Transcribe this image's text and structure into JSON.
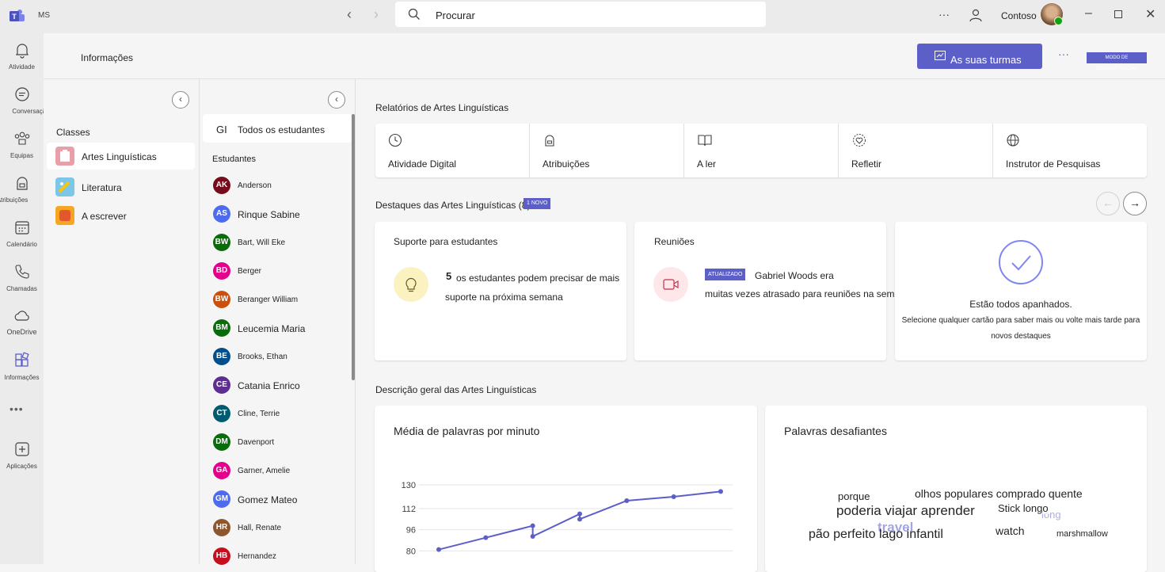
{
  "titlebar": {
    "org_short": "MS",
    "search_placeholder": "Procurar",
    "more": "···",
    "tenant": "Contoso"
  },
  "rail": [
    {
      "label": "Atividade",
      "icon": "bell-icon"
    },
    {
      "label": "Conversação",
      "icon": "chat-icon"
    },
    {
      "label": "Equipas",
      "icon": "teams-icon"
    },
    {
      "label": "Atribuições",
      "icon": "backpack-icon"
    },
    {
      "label": "Calendário",
      "icon": "calendar-icon"
    },
    {
      "label": "Chamadas",
      "icon": "phone-icon"
    },
    {
      "label": "OneDrive",
      "icon": "cloud-icon"
    },
    {
      "label": "Informações",
      "icon": "insights-icon"
    },
    {
      "label": "Aplicações",
      "icon": "add-apps-icon"
    }
  ],
  "rail_more": "•••",
  "header": {
    "title": "Informações",
    "primary_button": "As suas turmas",
    "more": "···",
    "demo_badge": "MODO DE DEMONSTRAÇÃO"
  },
  "classes": {
    "heading": "Classes",
    "items": [
      {
        "label": "Artes Linguísticas",
        "color": "#e8a0a8",
        "selected": true
      },
      {
        "label": "Literatura",
        "color": "#7cc7e8",
        "selected": false
      },
      {
        "label": "A escrever",
        "color": "#f5a623",
        "selected": false
      }
    ]
  },
  "students": {
    "all_initials": "GI",
    "all_label": "Todos os estudantes",
    "heading": "Estudantes",
    "items": [
      {
        "initials": "AK",
        "name": "Anderson",
        "color": "#750b1c"
      },
      {
        "initials": "AS",
        "name": "Rinque Sabine",
        "color": "#4f6bed"
      },
      {
        "initials": "BW",
        "name": "Bart, Will Eke",
        "color": "#0b6a0b"
      },
      {
        "initials": "BD",
        "name": "Berger",
        "color": "#e3008c"
      },
      {
        "initials": "BW",
        "name": "Beranger William",
        "color": "#ca5010"
      },
      {
        "initials": "BM",
        "name": "Leucemia Maria",
        "color": "#0b6a0b"
      },
      {
        "initials": "BE",
        "name": "Brooks, Ethan",
        "color": "#004e8c"
      },
      {
        "initials": "CE",
        "name": "Catania Enrico",
        "color": "#5c2e91"
      },
      {
        "initials": "CT",
        "name": "Cline, Terrie",
        "color": "#005b70"
      },
      {
        "initials": "DM",
        "name": "Davenport",
        "color": "#0b6a0b"
      },
      {
        "initials": "GA",
        "name": "Garner, Amelie",
        "color": "#e3008c"
      },
      {
        "initials": "GM",
        "name": "Gomez Mateo",
        "color": "#4f6bed"
      },
      {
        "initials": "HR",
        "name": "Hall, Renate",
        "color": "#8e562e"
      },
      {
        "initials": "HB",
        "name": "Hernandez",
        "color": "#c50f1f"
      }
    ]
  },
  "main": {
    "reports_title": "Relatórios de Artes Linguísticas",
    "reports": [
      {
        "label": "Atividade Digital",
        "icon": "clock-icon"
      },
      {
        "label": "Atribuições",
        "icon": "backpack-icon"
      },
      {
        "label": "A ler",
        "icon": "book-icon"
      },
      {
        "label": "Refletir",
        "icon": "heart-icon"
      },
      {
        "label": "Instrutor de Pesquisas",
        "icon": "globe-icon"
      }
    ],
    "highlights_title": "Destaques das Artes Linguísticas (8)",
    "highlights_badge": "1 NOVO",
    "support_card": {
      "title": "Suporte para estudantes",
      "count": "5",
      "line1": "os estudantes podem precisar de mais",
      "line2": "suporte na próxima semana"
    },
    "meetings_card": {
      "title": "Reuniões",
      "badge": "ATUALIZADO",
      "line1": "Gabriel Woods era",
      "line2": "muitas vezes atrasado para reuniões na semana passada"
    },
    "caught_up_card": {
      "title": "Estão todos apanhados.",
      "line1": "Selecione qualquer cartão para saber mais ou volte mais tarde para",
      "line2": "novos destaques"
    },
    "overview_title": "Descrição geral das Artes Linguísticas",
    "wpm_card_title": "Média de palavras por minuto",
    "challenging_card_title": "Palavras desafiantes",
    "word_cloud": [
      {
        "text": "porque"
      },
      {
        "text": "olhos populares comprado quente"
      },
      {
        "text": "poderia viajar aprender"
      },
      {
        "text": "Stick longo"
      },
      {
        "text": "pão perfeito lago infantil"
      },
      {
        "text": "watch"
      },
      {
        "text": "marshmallow"
      }
    ]
  },
  "chart_data": {
    "type": "line",
    "title": "Média de palavras por minuto",
    "yticks": [
      130,
      112,
      96,
      80
    ],
    "ylim": [
      76,
      136
    ],
    "points": [
      [
        0,
        81
      ],
      [
        1,
        90
      ],
      [
        2,
        99
      ],
      [
        2,
        91
      ],
      [
        3,
        108
      ],
      [
        3,
        104
      ],
      [
        4,
        118
      ],
      [
        5,
        121
      ],
      [
        6,
        125
      ]
    ],
    "series": [
      {
        "values": [
          81,
          90,
          99,
          91,
          108,
          104,
          118,
          121,
          125
        ]
      }
    ],
    "grid": true
  }
}
